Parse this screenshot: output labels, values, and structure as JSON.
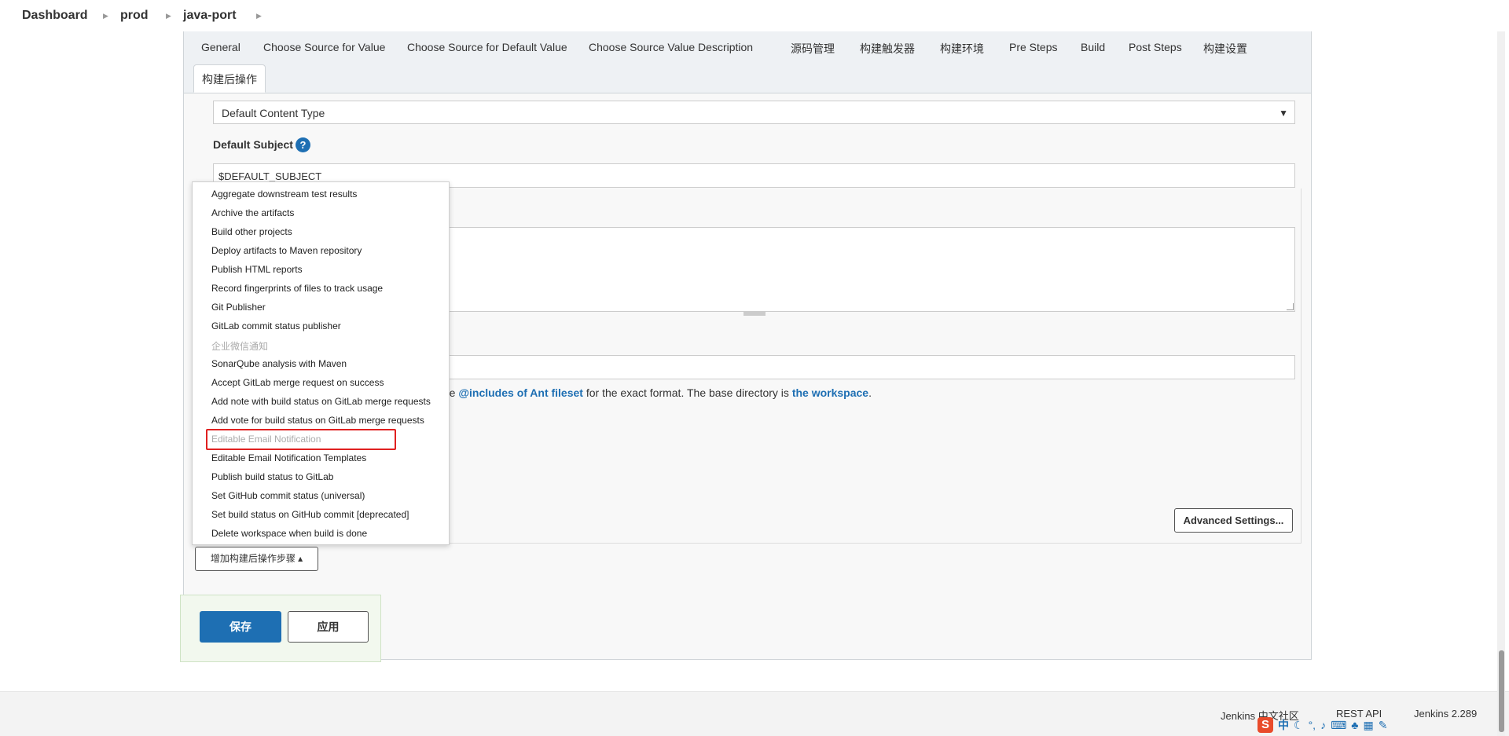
{
  "breadcrumb": {
    "items": [
      "Dashboard",
      "prod",
      "java-port"
    ],
    "separator": "›"
  },
  "tabs": [
    "General",
    "Choose Source for Value",
    "Choose Source for Default Value",
    "Choose Source Value Description",
    "源码管理",
    "构建触发器",
    "构建环境",
    "Pre Steps",
    "Build",
    "Post Steps",
    "构建设置"
  ],
  "active_tab": "构建后操作",
  "form": {
    "content_type_value": "Default Content Type",
    "default_subject_label": "Default Subject",
    "help_icon": "?",
    "default_subject_value": "$DEFAULT_SUBJECT",
    "help_prefix": "the",
    "help_link1": "@includes of Ant fileset",
    "help_middle": "for the exact format. The base directory is",
    "help_link2": "the workspace",
    "help_suffix": ".",
    "advanced_label": "Advanced Settings..."
  },
  "menu": {
    "items": [
      {
        "label": "Aggregate downstream test results",
        "disabled": false
      },
      {
        "label": "Archive the artifacts",
        "disabled": false
      },
      {
        "label": "Build other projects",
        "disabled": false
      },
      {
        "label": "Deploy artifacts to Maven repository",
        "disabled": false
      },
      {
        "label": "Publish HTML reports",
        "disabled": false
      },
      {
        "label": "Record fingerprints of files to track usage",
        "disabled": false
      },
      {
        "label": "Git Publisher",
        "disabled": false
      },
      {
        "label": "GitLab commit status publisher",
        "disabled": false
      },
      {
        "label": "企业微信通知",
        "disabled": true
      },
      {
        "label": "SonarQube analysis with Maven",
        "disabled": false
      },
      {
        "label": "Accept GitLab merge request on success",
        "disabled": false
      },
      {
        "label": "Add note with build status on GitLab merge requests",
        "disabled": false
      },
      {
        "label": "Add vote for build status on GitLab merge requests",
        "disabled": false
      },
      {
        "label": "Editable Email Notification",
        "disabled": true
      },
      {
        "label": "Editable Email Notification Templates",
        "disabled": false
      },
      {
        "label": "Publish build status to GitLab",
        "disabled": false
      },
      {
        "label": "Set GitHub commit status (universal)",
        "disabled": false
      },
      {
        "label": "Set build status on GitHub commit [deprecated]",
        "disabled": false
      },
      {
        "label": "Delete workspace when build is done",
        "disabled": false
      }
    ],
    "highlight_color": "#e02020"
  },
  "add_step_button": "增加构建后操作步骤 ▴",
  "save_label": "保存",
  "apply_label": "应用",
  "footer": {
    "community": "Jenkins 中文社区",
    "rest_api": "REST API",
    "version": "Jenkins 2.289"
  },
  "ime": {
    "logo": "S",
    "lang": "中"
  },
  "colors": {
    "primary": "#1e6fb3",
    "tab_bg": "#eef1f4",
    "save_panel_bg": "#f2f8ee"
  }
}
